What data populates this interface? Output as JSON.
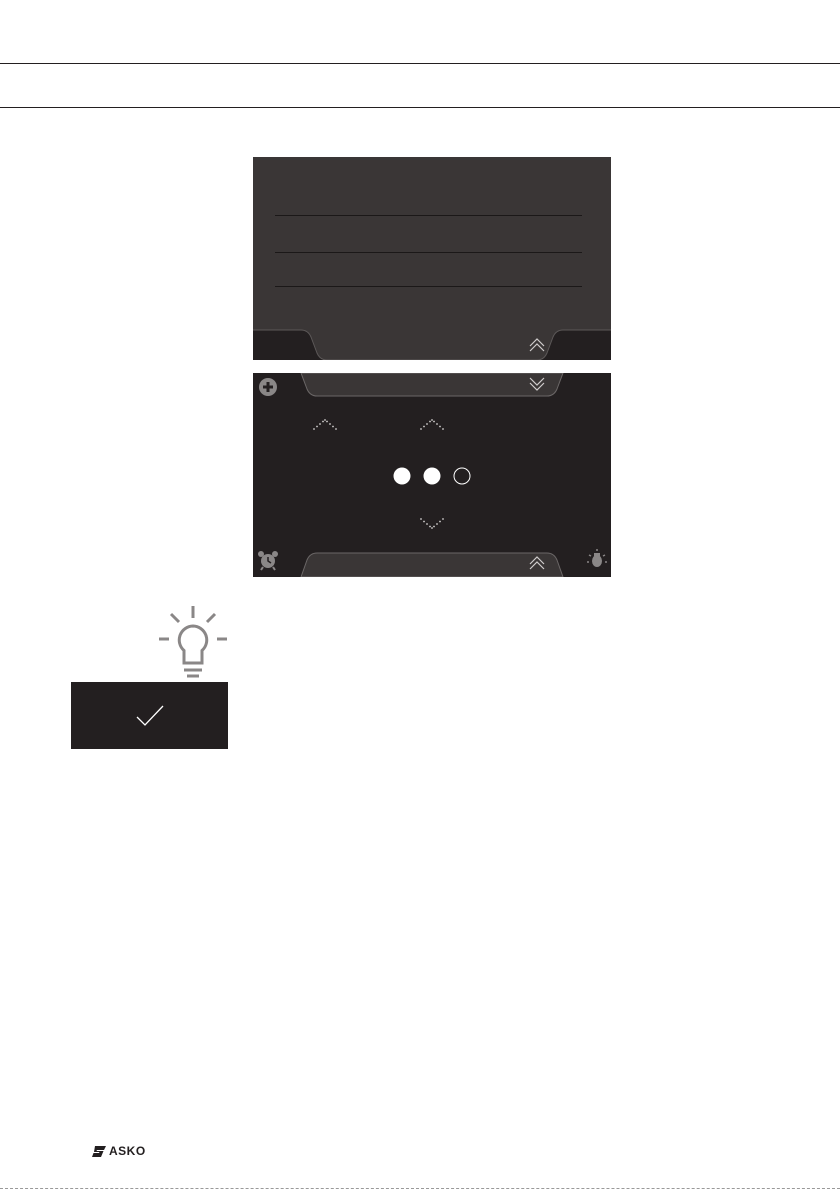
{
  "brand": {
    "name": "ASKO"
  },
  "screen_menu": {
    "menu_items": [
      "",
      "",
      "",
      ""
    ],
    "up_arrow_icon": "chevron-up-double-icon"
  },
  "screen_settings": {
    "top_arrow_icon": "chevron-down-double-icon",
    "bottom_arrow_icon": "chevron-up-double-icon",
    "pin_dots": [
      true,
      true,
      false
    ],
    "corner_icons": [
      "add-icon",
      "alarm-clock-icon",
      "oven-light-icon"
    ]
  },
  "tip": {
    "icon": "lightbulb-icon"
  },
  "confirm": {
    "icon": "checkmark-icon"
  },
  "colors": {
    "screen_bg_menu": "#3a3636",
    "screen_bg_settings": "#231f20",
    "accent_grey": "#8a8787"
  }
}
